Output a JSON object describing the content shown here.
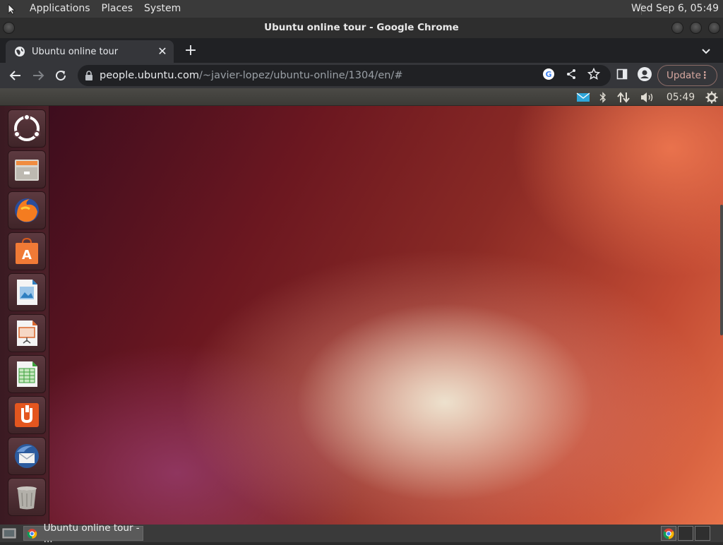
{
  "top_panel": {
    "menus": [
      "Applications",
      "Places",
      "System"
    ],
    "clock": "Wed Sep  6, 05:49"
  },
  "window": {
    "title": "Ubuntu online tour - Google Chrome"
  },
  "browser": {
    "tab_title": "Ubuntu online tour",
    "tab_close": "✕",
    "new_tab": "+",
    "url_host": "people.ubuntu.com",
    "url_path": "/~javier-lopez/ubuntu-online/1304/en/#",
    "update_label": "Update",
    "update_menu": "⋮"
  },
  "ubuntu_tour": {
    "panel_time": "05:49",
    "indicators": [
      "mail-icon",
      "bluetooth-icon",
      "network-icon",
      "volume-icon",
      "gear-icon"
    ],
    "launcher": [
      "ubuntu-dash-icon",
      "files-icon",
      "firefox-icon",
      "software-center-icon",
      "libreoffice-draw-icon",
      "libreoffice-impress-icon",
      "libreoffice-calc-icon",
      "ubuntu-one-icon",
      "thunderbird-icon",
      "trash-icon"
    ]
  },
  "bottom_panel": {
    "task_label": "Ubuntu online tour - ..."
  },
  "colors": {
    "panel": "#3a3a3a",
    "chrome_dark": "#202124",
    "chrome_toolbar": "#35363a",
    "ubuntu_orange": "#e95420"
  }
}
